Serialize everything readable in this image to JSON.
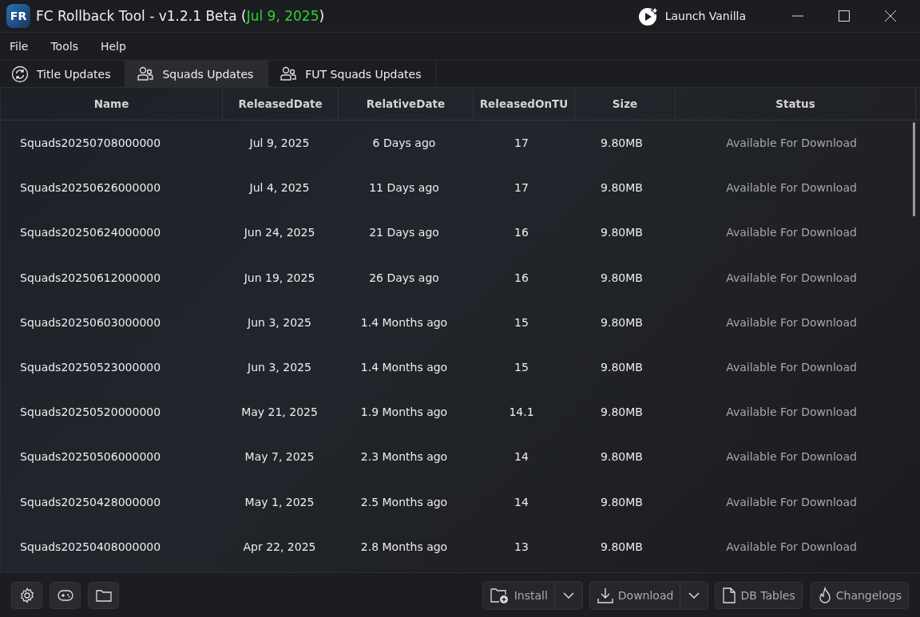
{
  "window": {
    "logo": "FR",
    "title": "FC Rollback Tool - v1.2.1 Beta (",
    "title_date": "Jul 9, 2025",
    "title_end": ")",
    "launch_button": "Launch Vanilla"
  },
  "menu": [
    "File",
    "Tools",
    "Help"
  ],
  "tabs": [
    {
      "label": "Title Updates",
      "kind": "refresh",
      "selected": false
    },
    {
      "label": "Squads Updates",
      "kind": "people",
      "selected": true
    },
    {
      "label": "FUT Squads Updates",
      "kind": "people",
      "selected": false
    }
  ],
  "table": {
    "columns": [
      "Name",
      "ReleasedDate",
      "RelativeDate",
      "ReleasedOnTU",
      "Size",
      "Status"
    ],
    "rows": [
      [
        "Squads20250708000000",
        "Jul 9, 2025",
        "6 Days ago",
        "17",
        "9.80MB",
        "Available For Download"
      ],
      [
        "Squads20250626000000",
        "Jul 4, 2025",
        "11 Days ago",
        "17",
        "9.80MB",
        "Available For Download"
      ],
      [
        "Squads20250624000000",
        "Jun 24, 2025",
        "21 Days ago",
        "16",
        "9.80MB",
        "Available For Download"
      ],
      [
        "Squads20250612000000",
        "Jun 19, 2025",
        "26 Days ago",
        "16",
        "9.80MB",
        "Available For Download"
      ],
      [
        "Squads20250603000000",
        "Jun 3, 2025",
        "1.4 Months ago",
        "15",
        "9.80MB",
        "Available For Download"
      ],
      [
        "Squads20250523000000",
        "Jun 3, 2025",
        "1.4 Months ago",
        "15",
        "9.80MB",
        "Available For Download"
      ],
      [
        "Squads20250520000000",
        "May 21, 2025",
        "1.9 Months ago",
        "14.1",
        "9.80MB",
        "Available For Download"
      ],
      [
        "Squads20250506000000",
        "May 7, 2025",
        "2.3 Months ago",
        "14",
        "9.80MB",
        "Available For Download"
      ],
      [
        "Squads20250428000000",
        "May 1, 2025",
        "2.5 Months ago",
        "14",
        "9.80MB",
        "Available For Download"
      ],
      [
        "Squads20250408000000",
        "Apr 22, 2025",
        "2.8 Months ago",
        "13",
        "9.80MB",
        "Available For Download"
      ]
    ]
  },
  "footer": {
    "install": "Install",
    "download": "Download",
    "db_tables": "DB Tables",
    "changelogs": "Changelogs"
  }
}
